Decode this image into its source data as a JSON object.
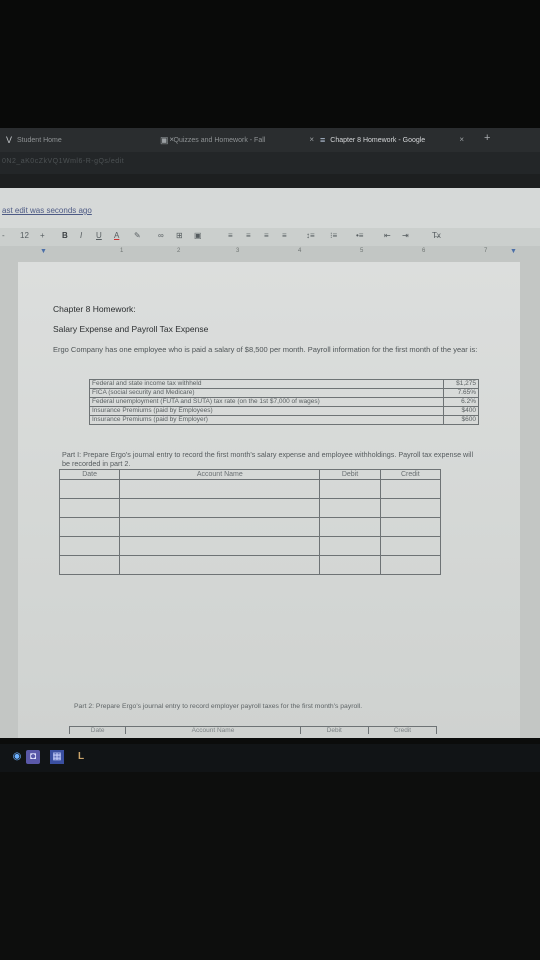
{
  "browser": {
    "tabs": [
      {
        "icon": "uv-logo-icon",
        "label": "Student Home"
      },
      {
        "icon": "course-icon",
        "label": "Quizzes and Homework - Fall"
      },
      {
        "icon": "docs-icon",
        "label": "Chapter 8 Homework - Google"
      }
    ],
    "tab_close": "×",
    "new_tab": "+",
    "url_fragment": "0N2_aK0cZkVQ1Wml6-R-gQs/edit"
  },
  "docs": {
    "last_edit": "ast edit was seconds ago",
    "toolbar": {
      "font_size": "12",
      "size_plus": "+",
      "bold": "B",
      "italic": "I",
      "underline": "U",
      "text_color": "A"
    },
    "ruler_numbers": [
      "1",
      "2",
      "3",
      "4",
      "5",
      "6",
      "7"
    ]
  },
  "document": {
    "title": "Chapter 8 Homework:",
    "subtitle": "Salary Expense and Payroll Tax Expense",
    "intro": "Ergo Company has one employee who is paid a salary of $8,500 per month. Payroll information for the first month of the year is:",
    "payroll_info": [
      {
        "label": "Federal and state income tax withheld",
        "value": "$1,275"
      },
      {
        "label": "FICA (social security and Medicare)",
        "value": "7.65%"
      },
      {
        "label": "Federal unemployment (FUTA and SUTA) tax rate (on the 1st $7,000 of wages)",
        "value": "6.2%"
      },
      {
        "label": "Insurance Premiums (paid by Employees)",
        "value": "$400"
      },
      {
        "label": "Insurance Premiums (paid by Employer)",
        "value": "$600"
      }
    ],
    "part1": "Part I: Prepare Ergo's journal entry to record the first month's salary expense and employee withholdings. Payroll tax expense will be recorded in part 2.",
    "journal_headers": {
      "date": "Date",
      "account": "Account Name",
      "debit": "Debit",
      "credit": "Credit"
    },
    "part2": "Part 2: Prepare Ergo's journal entry to record employer payroll taxes for the first month's payroll."
  },
  "colors": {
    "page": "#d6d9d8",
    "link": "#4d5a85",
    "text": "#2b2e30"
  }
}
